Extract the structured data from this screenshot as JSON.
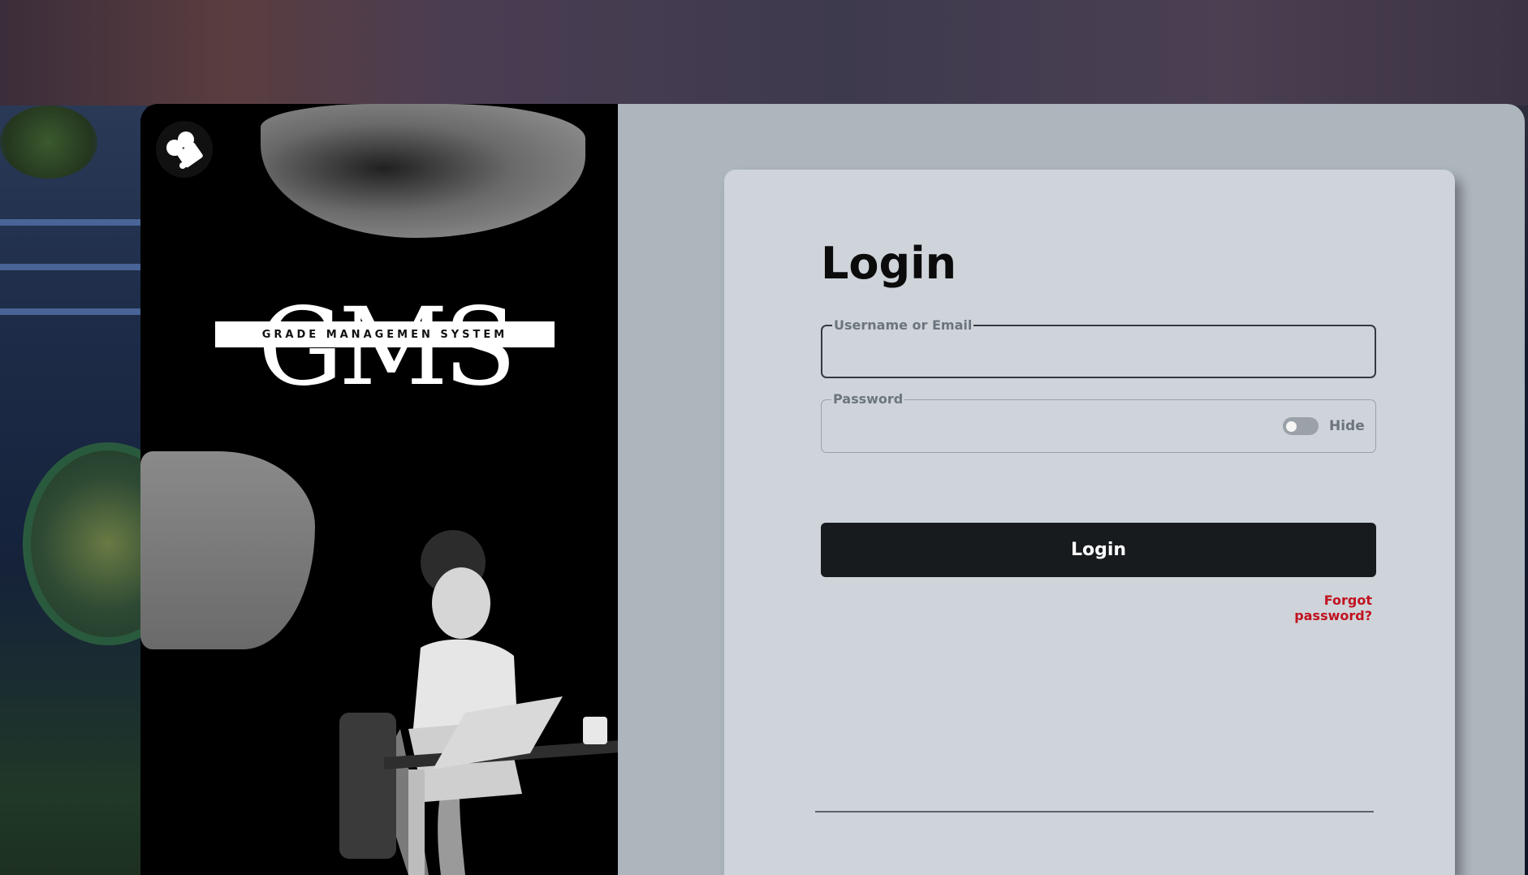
{
  "brand": {
    "logo_letters": "GMS",
    "tagline": "GRADE MANAGEMEN SYSTEM"
  },
  "login": {
    "title": "Login",
    "username_label": "Username or Email",
    "username_value": "",
    "password_label": "Password",
    "password_value": "",
    "toggle_label": "Hide",
    "submit_label": "Login",
    "forgot_label": "Forgot password?"
  },
  "colors": {
    "button_bg": "#181b1e",
    "forgot_link": "#c1121f",
    "form_bg": "#ced4da",
    "panel_bg": "#adb5bd"
  },
  "icons": {
    "app_logo": "app-logo-icon",
    "toggle": "visibility-toggle-icon"
  }
}
